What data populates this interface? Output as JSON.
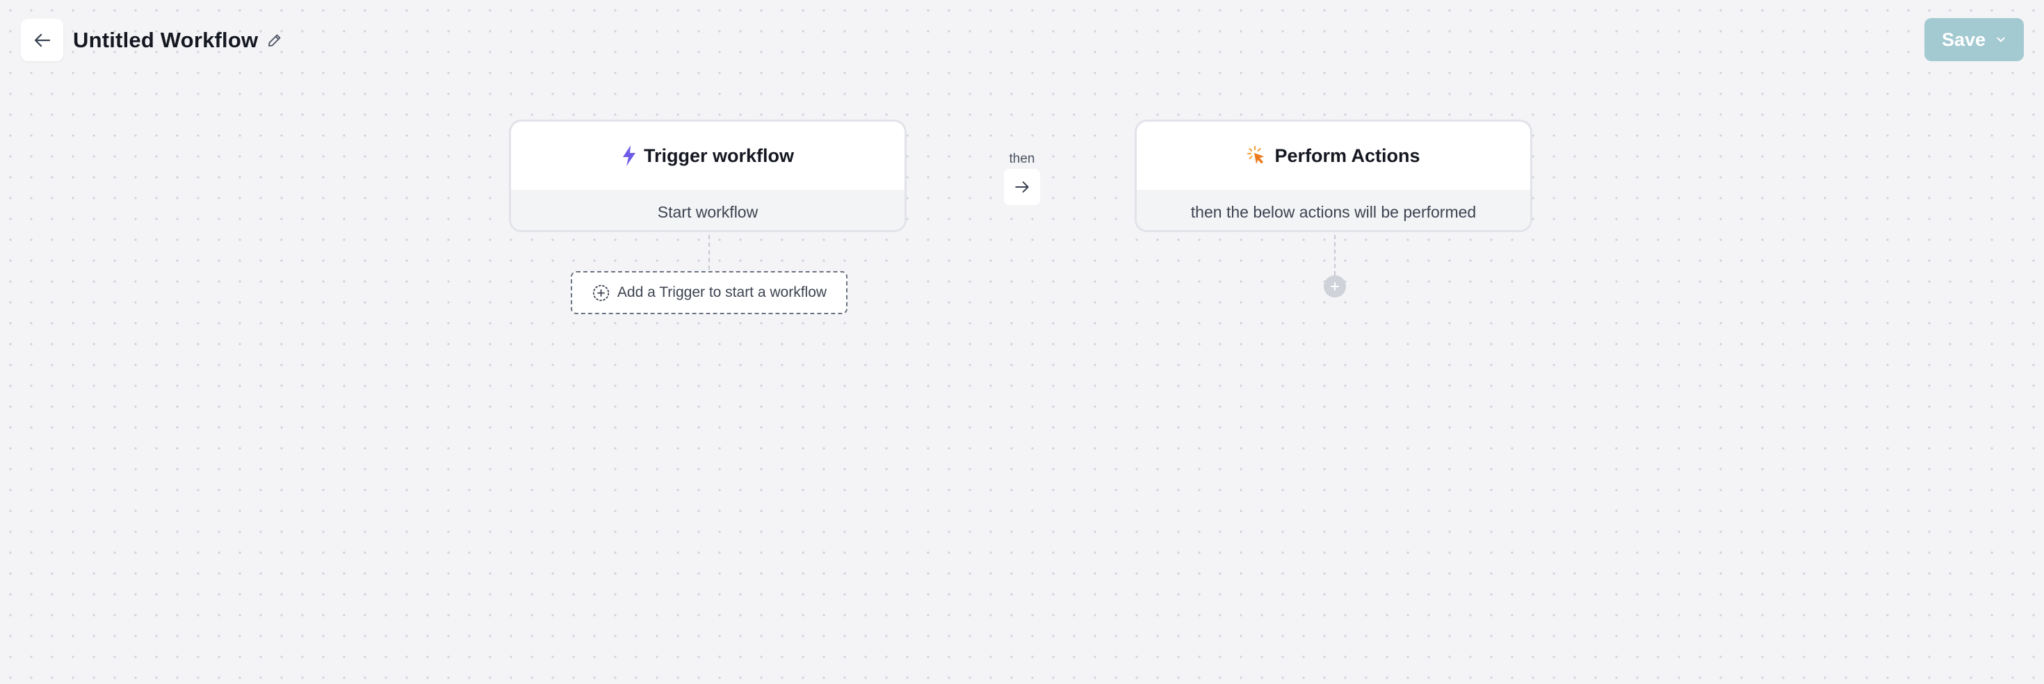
{
  "header": {
    "title": "Untitled Workflow",
    "save_label": "Save",
    "save_color": "#a3c9d1"
  },
  "icons": {
    "back": "arrow-left-icon",
    "edit": "pencil-icon",
    "save_menu": "chevron-down-icon",
    "trigger": "lightning-icon",
    "actions": "click-cursor-icon",
    "connector": "arrow-right-icon",
    "add_trigger": "plus-circle-icon",
    "add_action": "plus-icon"
  },
  "trigger_card": {
    "title": "Trigger workflow",
    "subtitle": "Start workflow",
    "icon_color": "#6d5ce8"
  },
  "connector": {
    "label": "then"
  },
  "actions_card": {
    "title": "Perform Actions",
    "subtitle": "then the below actions will be performed",
    "icon_color": "#f08c2e"
  },
  "add_trigger": {
    "label": "Add a Trigger to start a workflow"
  }
}
